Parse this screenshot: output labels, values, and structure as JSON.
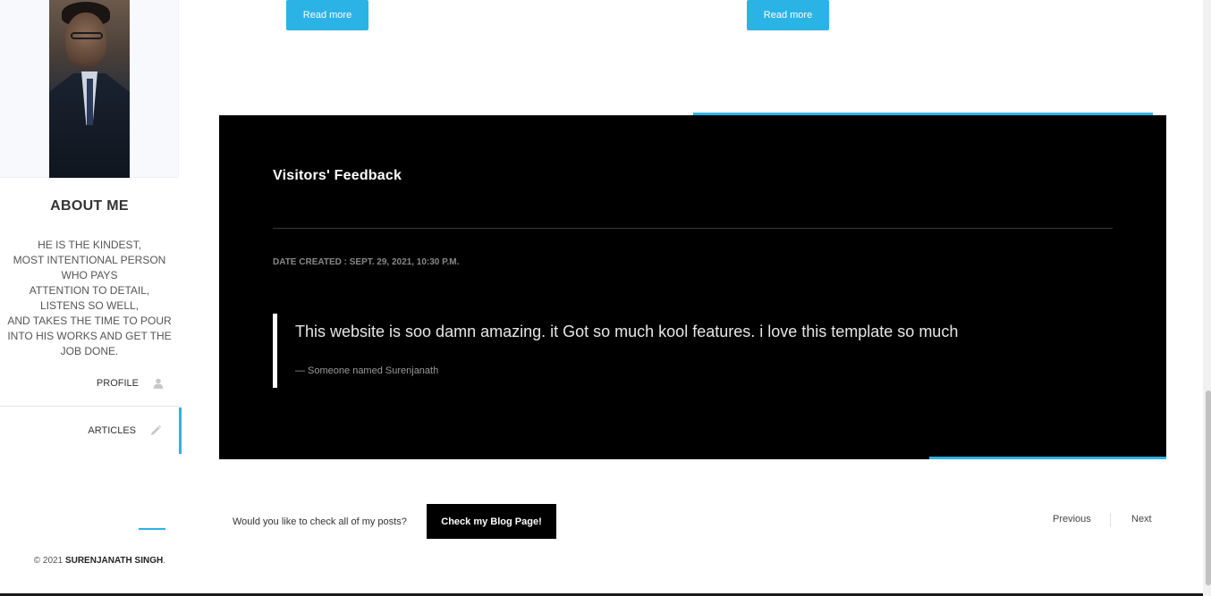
{
  "sidebar": {
    "about_title": "ABOUT ME",
    "about_lines": [
      "HE IS THE KINDEST,",
      "MOST INTENTIONAL PERSON",
      "WHO PAYS",
      "ATTENTION TO DETAIL,",
      "LISTENS SO WELL,",
      "AND TAKES THE TIME TO POUR",
      "INTO HIS WORKS AND GET THE",
      "JOB DONE."
    ],
    "nav": [
      {
        "label": "PROFILE",
        "icon": "user-icon",
        "active": false
      },
      {
        "label": "ARTICLES",
        "icon": "pencil-icon",
        "active": true
      }
    ],
    "copyright_prefix": "© 2021 ",
    "copyright_name": "SURENJANATH SINGH",
    "copyright_suffix": "."
  },
  "main": {
    "read_more_label": "Read more",
    "feedback": {
      "title": "Visitors' Feedback",
      "date_created": "DATE CREATED : SEPT. 29, 2021, 10:30 P.M.",
      "quote": "This website is soo damn amazing. it Got so much kool features. i love this template so much",
      "author": "— Someone named Surenjanath"
    },
    "check_posts_text": "Would you like to check all of my posts?",
    "blog_button_label": "Check my Blog Page!",
    "pagination": {
      "previous": "Previous",
      "next": "Next"
    }
  },
  "colors": {
    "accent": "#2bb3e6",
    "feedback_bg": "#000000",
    "button_dark": "#000000"
  }
}
